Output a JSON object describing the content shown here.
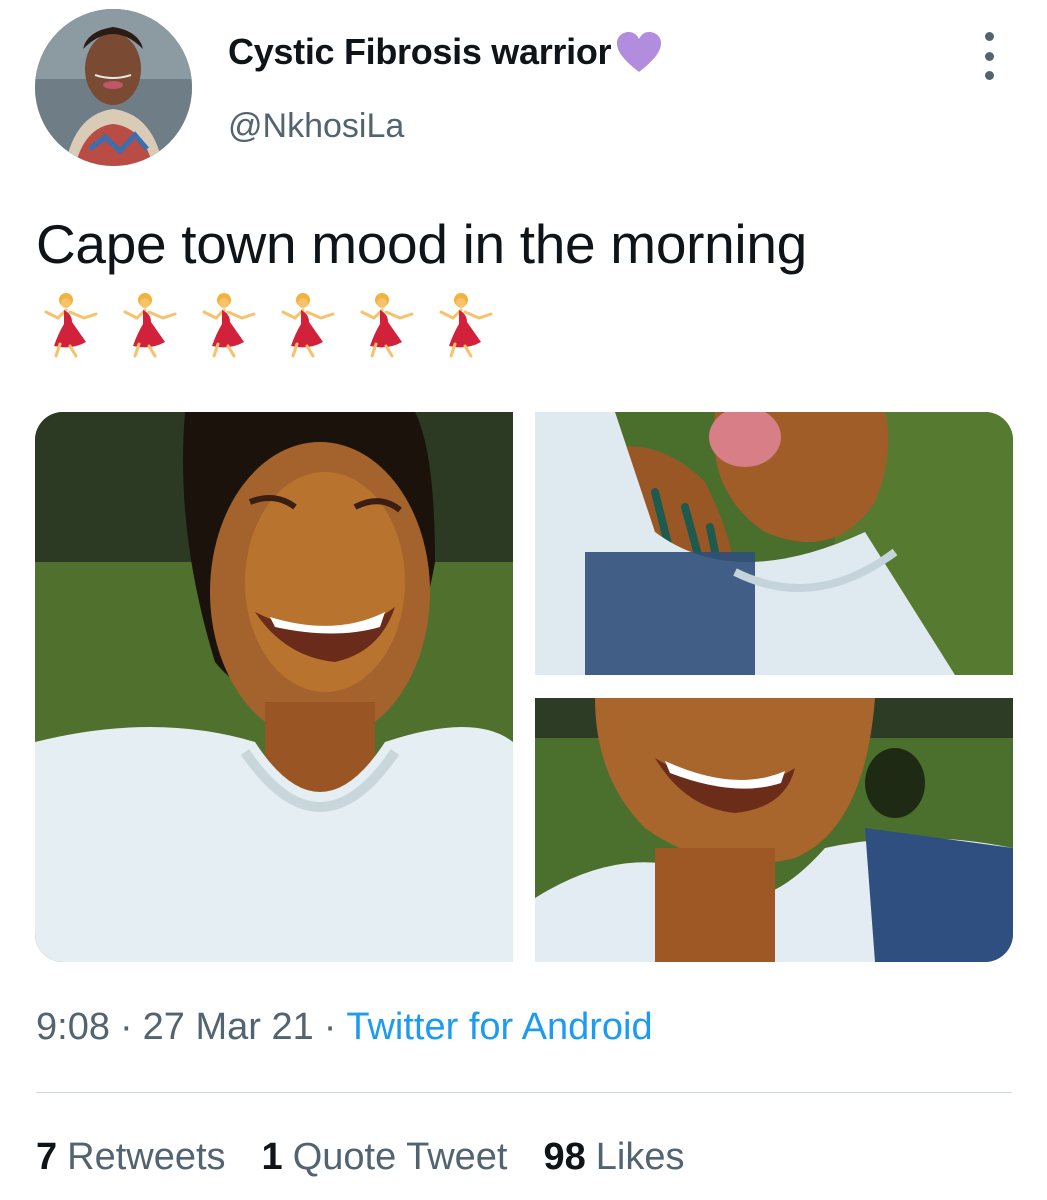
{
  "user": {
    "display_name": "Cystic Fibrosis warrior",
    "handle": "@NkhosiLa",
    "avatar_icon": "profile-photo",
    "badge_icon": "purple-heart-icon",
    "badge_color": "#b28dde"
  },
  "more_icon": "more-vertical-icon",
  "tweet": {
    "text": "Cape town mood in the morning",
    "emojis": [
      "dancer",
      "dancer",
      "dancer",
      "dancer",
      "dancer",
      "dancer"
    ],
    "media_count": 3
  },
  "meta": {
    "time": "9:08",
    "separator": "·",
    "date": "27 Mar 21",
    "source": "Twitter for Android"
  },
  "stats": {
    "retweets_count": "7",
    "retweets_label": "Retweets",
    "quotes_count": "1",
    "quotes_label": "Quote Tweet",
    "likes_count": "98",
    "likes_label": "Likes"
  },
  "colors": {
    "name": "#0f1419",
    "secondary": "#536471",
    "link": "#1d9bf0",
    "divider": "#cfd9de"
  }
}
